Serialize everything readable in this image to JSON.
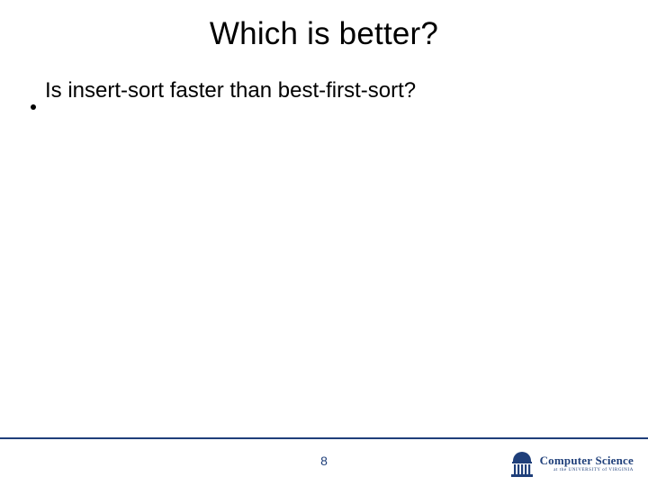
{
  "slide": {
    "title": "Which is better?",
    "bullets": [
      {
        "text": "Is insert-sort faster than best-first-sort?"
      }
    ],
    "page_number": "8"
  },
  "footer": {
    "logo_main": "Computer Science",
    "logo_sub": "at the UNIVERSITY of VIRGINIA"
  },
  "colors": {
    "accent": "#1f3f7a"
  }
}
